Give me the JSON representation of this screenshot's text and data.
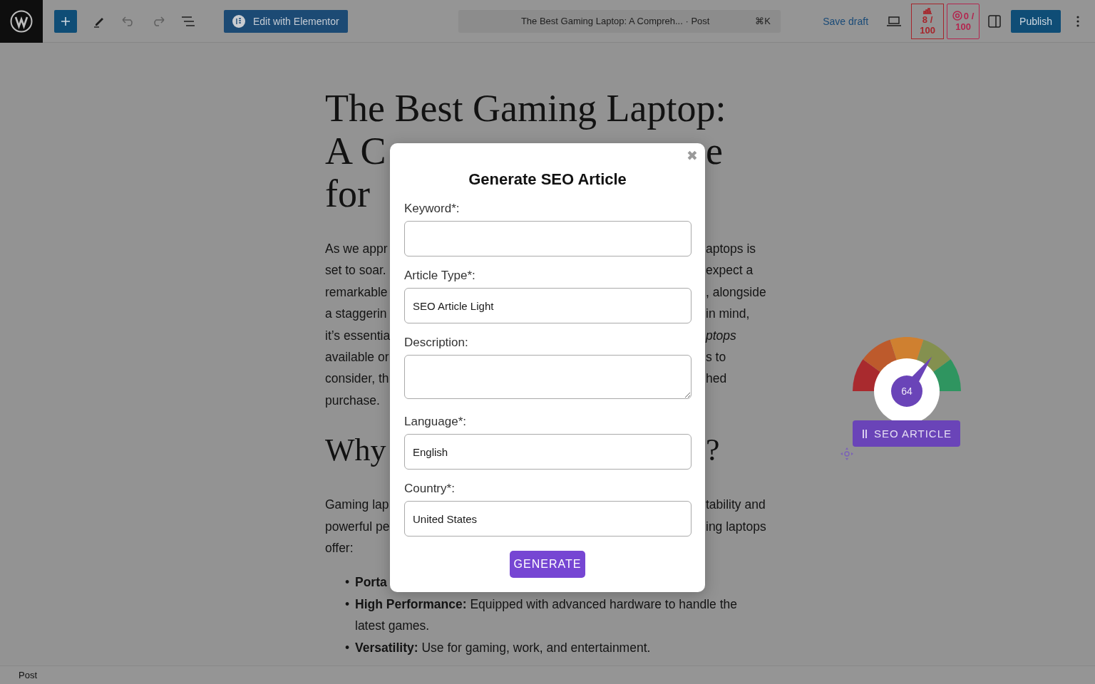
{
  "toolbar": {
    "edit_button": "Edit with Elementor",
    "command_bar": {
      "title": "The Best Gaming Laptop: A Compreh... · Post",
      "shortcut": "⌘K"
    },
    "save_draft": "Save draft",
    "score_badges": [
      {
        "kind": "chart",
        "value": "8 /",
        "total": "100"
      },
      {
        "kind": "at",
        "value": "0 /",
        "total": "100"
      }
    ],
    "publish": "Publish"
  },
  "article": {
    "title_lines": [
      {
        "left": "The Best Gaming Laptop:"
      },
      {
        "left": "A C",
        "right": "e"
      },
      {
        "left": "for"
      }
    ],
    "paragraph_1": [
      {
        "left": "As we appr",
        "right": "aptops is"
      },
      {
        "left": "set to soar.",
        "right": "expect a"
      },
      {
        "left": "remarkable",
        "right": ", alongside"
      },
      {
        "left": "a staggerin",
        "right": "in mind,"
      },
      {
        "left": "it’s essentia",
        "right": "*ptops*"
      },
      {
        "left": "available or",
        "right": "s to"
      },
      {
        "left": "consider, th",
        "right": "hed"
      },
      {
        "left": "purchase."
      }
    ],
    "heading": {
      "left": "Why",
      "right": "?"
    },
    "paragraph_2": [
      {
        "left": "Gaming lap",
        "right": "tability and"
      },
      {
        "left": "powerful pe",
        "right": "ing laptops"
      },
      {
        "left": "offer:"
      }
    ],
    "bullets": [
      {
        "marker": "•",
        "term": "Porta"
      },
      {
        "marker": "•",
        "term": "High Performance:",
        "text": "Equipped with advanced hardware to handle the latest games."
      },
      {
        "marker": "•",
        "term": "Versatility:",
        "text": "Use for gaming, work, and entertainment."
      }
    ]
  },
  "seo_widget": {
    "score": "64",
    "button": "SEO ARTICLE"
  },
  "modal": {
    "title": "Generate SEO Article",
    "close": "✖",
    "fields": [
      {
        "kind": "input",
        "label": "Keyword*:"
      },
      {
        "kind": "input",
        "label": "Article Type*:",
        "value": "SEO Article Light"
      },
      {
        "kind": "textarea",
        "label": "Description:"
      },
      {
        "kind": "input",
        "label": "Language*:",
        "value": "English"
      },
      {
        "kind": "input",
        "label": "Country*:",
        "value": "United States"
      }
    ],
    "button": "GENERATE"
  },
  "status_bar": {
    "breadcrumb": "Post"
  }
}
